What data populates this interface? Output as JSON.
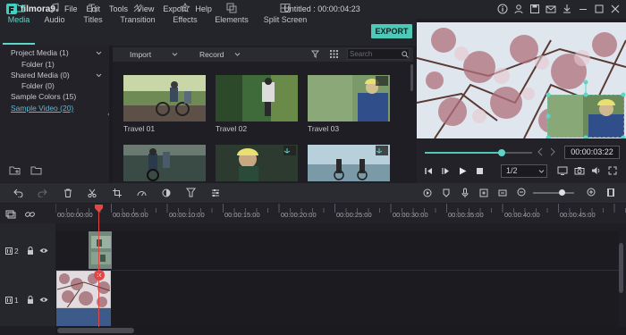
{
  "app": {
    "name": "filmora9"
  },
  "menu": [
    "File",
    "Edit",
    "Tools",
    "View",
    "Export",
    "Help"
  ],
  "title": "Untitled : 00:00:04:23",
  "tabs": [
    {
      "label": "Media",
      "icon": "folder-icon",
      "active": true
    },
    {
      "label": "Audio",
      "icon": "music-note-icon"
    },
    {
      "label": "Titles",
      "icon": "text-icon"
    },
    {
      "label": "Transition",
      "icon": "transition-icon"
    },
    {
      "label": "Effects",
      "icon": "effects-icon"
    },
    {
      "label": "Elements",
      "icon": "elements-icon"
    },
    {
      "label": "Split Screen",
      "icon": "split-screen-icon"
    }
  ],
  "export_label": "EXPORT",
  "library": {
    "project_media": "Project Media (1)",
    "project_folder": "Folder (1)",
    "shared_media": "Shared Media (0)",
    "shared_folder": "Folder (0)",
    "sample_colors": "Sample Colors (15)",
    "sample_video": "Sample Video (20)"
  },
  "media_toolbar": {
    "import": "Import",
    "record": "Record",
    "search_placeholder": "Search"
  },
  "media_items": [
    {
      "label": "Travel 01"
    },
    {
      "label": "Travel 02"
    },
    {
      "label": "Travel 03"
    },
    {
      "label": ""
    },
    {
      "label": ""
    },
    {
      "label": ""
    }
  ],
  "preview": {
    "timecode": "00:00:03:22",
    "quality": "1/2",
    "progress": 0.72
  },
  "ruler": [
    "00:00:00:00",
    "00:00:05:00",
    "00:00:10:00",
    "00:00:15:00",
    "00:00:20:00",
    "00:00:25:00",
    "00:00:30:00",
    "00:00:35:00",
    "00:00:40:00",
    "00:00:45:00"
  ],
  "tracks": [
    {
      "label": "2"
    },
    {
      "label": "1"
    }
  ],
  "colors": {
    "accent": "#4ec9b8",
    "playhead": "#e04848",
    "audio": "#3d5b8a"
  }
}
